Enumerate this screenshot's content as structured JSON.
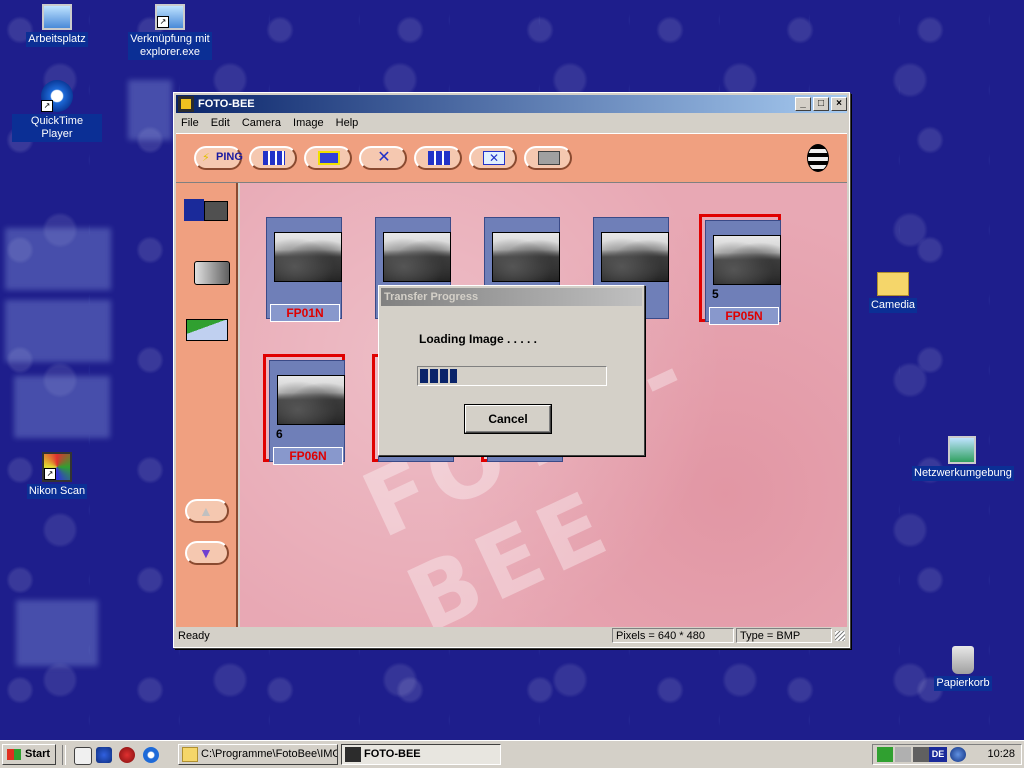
{
  "desktop": {
    "icons": [
      {
        "label": "Arbeitsplatz"
      },
      {
        "label": "Verknüpfung mit explorer.exe"
      },
      {
        "label": "QuickTime Player"
      },
      {
        "label": "Nikon Scan"
      },
      {
        "label": "Camedia"
      },
      {
        "label": "Netzwerkumgebung"
      },
      {
        "label": "Papierkorb"
      }
    ]
  },
  "window": {
    "title": "FOTO-BEE",
    "menu": [
      "File",
      "Edit",
      "Camera",
      "Image",
      "Help"
    ],
    "toolbar": {
      "ping_label": "PING"
    },
    "watermark": "FOTO-BEE",
    "thumbnails": [
      {
        "name": "FP01N",
        "number": "",
        "selected": false
      },
      {
        "name": "",
        "number": "",
        "selected": false
      },
      {
        "name": "",
        "number": "",
        "selected": false
      },
      {
        "name": "",
        "number": "",
        "selected": false
      },
      {
        "name": "FP05N",
        "number": "5",
        "selected": true
      },
      {
        "name": "FP06N",
        "number": "6",
        "selected": true
      }
    ],
    "status": {
      "ready": "Ready",
      "pixels": "Pixels = 640 * 480",
      "type": "Type = BMP"
    }
  },
  "dialog": {
    "title": "Transfer Progress",
    "message": "Loading Image . . . . .",
    "progress_fraction": 0.2,
    "cancel_label": "Cancel"
  },
  "taskbar": {
    "start_label": "Start",
    "tasks": [
      {
        "label": "C:\\Programme\\FotoBee\\IMG"
      },
      {
        "label": "FOTO-BEE"
      }
    ],
    "tray_language": "DE",
    "clock": "10:28"
  },
  "colors": {
    "accent": "#f0a080",
    "selection": "#e00000",
    "titlebar": "#0a246a"
  }
}
